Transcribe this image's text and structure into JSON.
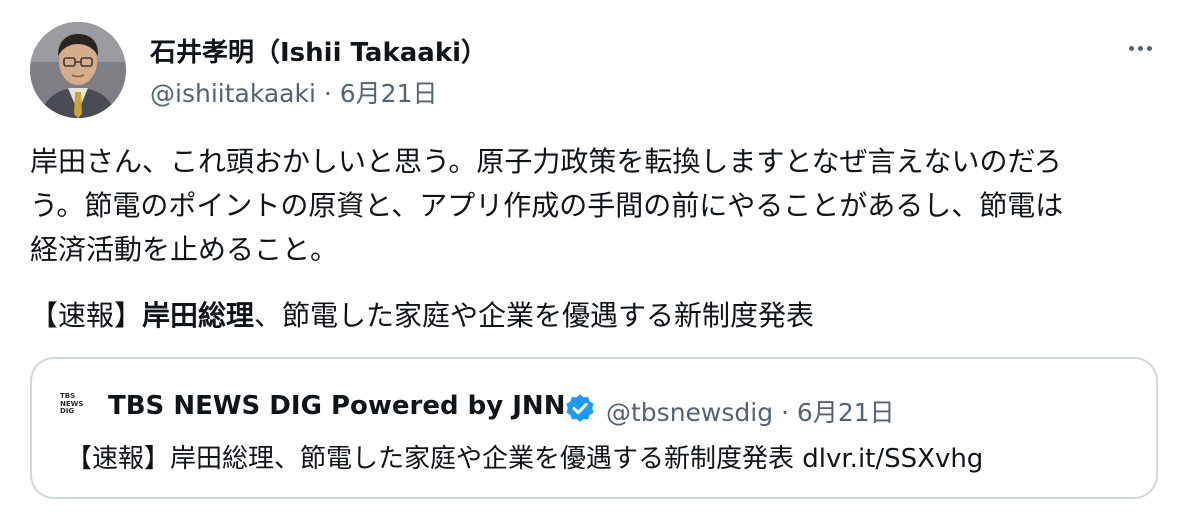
{
  "author": {
    "display_name": "石井孝明（Ishii Takaaki）",
    "handle": "@ishiitakaaki",
    "separator": " · ",
    "date": "6月21日"
  },
  "tweet": {
    "lines": [
      "岸田さん、これ頭おかしいと思う。原子力政策を転換しますとなぜ言えないのだろ",
      "う。節電のポイントの原資と、アプリ作成の手間の前にやることがあるし、節電は",
      "経済活動を止めること。"
    ],
    "headline_prefix": "【速報】",
    "headline_bold": "岸田総理",
    "headline_rest": "、節電した家庭や企業を優遇する新制度発表"
  },
  "quote": {
    "logo_lines": [
      "TBS",
      "NEWS",
      "DIG"
    ],
    "name": "TBS NEWS DIG Powered by JNN",
    "handle": "@tbsnewsdig",
    "separator": " · ",
    "date": "6月21日",
    "text": "【速報】岸田総理、節電した家庭や企業を優遇する新制度発表 dlvr.it/SSXvhg"
  },
  "colors": {
    "text": "#0f1419",
    "secondary": "#536471",
    "border": "#cfd9de",
    "verified": "#1d9bf0"
  },
  "icons": {
    "more": "more-horizontal-icon",
    "verified": "verified-badge-icon"
  }
}
